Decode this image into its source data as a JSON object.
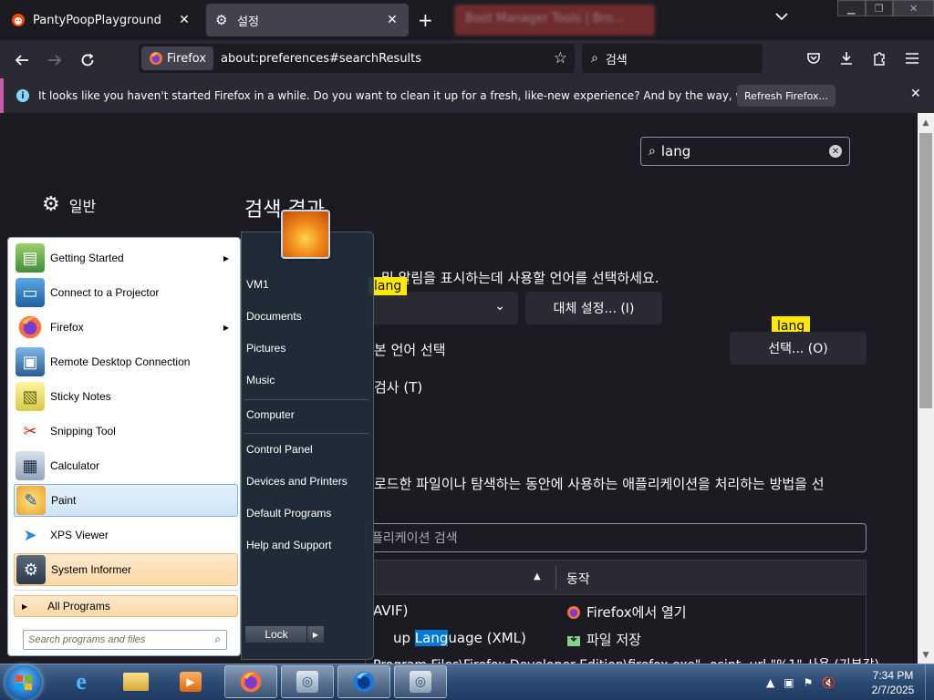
{
  "browser": {
    "tabs": [
      {
        "title": "PantyPoopPlayground",
        "close": "✕"
      },
      {
        "title": "설정",
        "close": "✕"
      }
    ],
    "new_tab": "+",
    "blurred_tab": "Boot Manager Tools | Bro...",
    "identity_label": "Firefox",
    "url": "about:preferences#searchResults",
    "search_placeholder": "검색"
  },
  "notice": {
    "message": "It looks like you haven't started Firefox in a while. Do you want to clean it up for a fresh, like-new experience? And by the way, welcome back!",
    "button": "Refresh Firefox..."
  },
  "prefs": {
    "search_value": "lang",
    "category_general": "일반",
    "results_heading": "검색 결과",
    "lang_desc": "…메뉴, 메시지 및 알림을 표시하는데 사용할 언어를 선택하세요.",
    "lang_desc_visible": "및 알림을 표시하는데 사용할 언어를 선택하세요.",
    "alt_settings_btn": "대체 설정... (I)",
    "highlight_label": "lang",
    "web_lang_text": "본 언어 선택",
    "choose_btn": "선택... (O)",
    "spell_text": "검사 (T)",
    "apps_desc": "로드한 파일이나 탐색하는 동안에 사용하는 애플리케이션을 처리하는 방법을 선",
    "apps_search_placeholder": "플리케이션 검색",
    "table_action_header": "동작",
    "rows": [
      {
        "type": "AVIF)",
        "action": "Firefox에서 열기"
      },
      {
        "type_pre": "up ",
        "type_mark": "Lang",
        "type_post": "uage (XML)",
        "action": "파일 저장"
      },
      {
        "type": "Program Files\\Firefox Developer Edition\\firefox.exe\" -osint -url \"%1\" 사용 (기본값)"
      }
    ]
  },
  "start_menu": {
    "programs": [
      {
        "label": "Getting Started",
        "icon": "getting-started-icon",
        "has_arrow": true
      },
      {
        "label": "Connect to a Projector",
        "icon": "projector-icon",
        "has_arrow": false
      },
      {
        "label": "Firefox",
        "icon": "firefox-icon",
        "has_arrow": true
      },
      {
        "label": "Remote Desktop Connection",
        "icon": "remote-desktop-icon",
        "has_arrow": false
      },
      {
        "label": "Sticky Notes",
        "icon": "sticky-notes-icon",
        "has_arrow": false
      },
      {
        "label": "Snipping Tool",
        "icon": "scissors-icon",
        "has_arrow": false
      },
      {
        "label": "Calculator",
        "icon": "calculator-icon",
        "has_arrow": false
      },
      {
        "label": "Paint",
        "icon": "paint-icon",
        "has_arrow": false
      },
      {
        "label": "XPS Viewer",
        "icon": "xps-viewer-icon",
        "has_arrow": false
      },
      {
        "label": "System Informer",
        "icon": "system-informer-icon",
        "has_arrow": false
      }
    ],
    "all_programs": "All Programs",
    "search_placeholder": "Search programs and files",
    "right_links": [
      "VM1",
      "Documents",
      "Pictures",
      "Music",
      "Computer",
      "Control Panel",
      "Devices and Printers",
      "Default Programs",
      "Help and Support"
    ],
    "lock_label": "Lock"
  },
  "taskbar": {
    "time": "7:34 PM",
    "date": "2/7/2025"
  },
  "colors": {
    "firefox_bg": "#1c1b22",
    "firefox_toolbar": "#2b2a33",
    "find_highlight": "#ffe900",
    "notice_accent": "#c75eac",
    "taskbar_blue": "#2b4a73"
  }
}
